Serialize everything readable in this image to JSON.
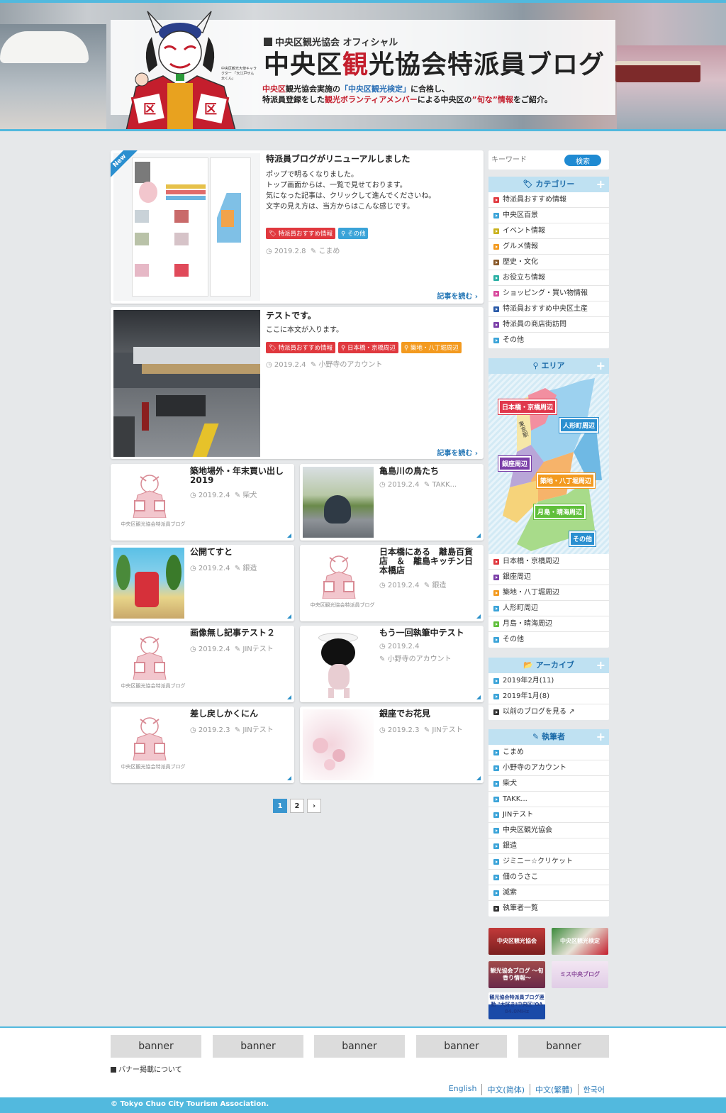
{
  "header": {
    "official": "中央区観光協会 オフィシャル",
    "title_pre": "中央区",
    "title_red": "観",
    "title_post": "光協会特派員ブログ",
    "tag1_a": "中央区",
    "tag1_b": "観光協会実施の",
    "tag1_c": "「中央区観光検定」",
    "tag1_d": "に合格し、",
    "tag2_a": "特派員登録をした",
    "tag2_b": "観光ボランティアメンバー",
    "tag2_c": "による中央区の",
    "tag2_d": "”旬な”情報",
    "tag2_e": "をご紹介。",
    "mascot_side": "中央区観光大使キャラクター 「大江戸せん太くん」"
  },
  "featured": [
    {
      "badge": "New",
      "title": "特派員ブログがリニューアルしました",
      "excerpt": [
        "ポップで明るくなりました。",
        "トップ画面からは、一覧で見せております。",
        "気になった記事は、クリックして進んでくださいね。",
        "文字の見え方は、当方からはこんな感じです。"
      ],
      "tags": [
        "特派員おすすめ情報",
        "その他"
      ],
      "date": "2019.2.8",
      "author": "こまめ",
      "readmore": "記事を読む"
    },
    {
      "title": "テストです。",
      "excerpt": [
        "ここに本文が入ります。"
      ],
      "tags": [
        "特派員おすすめ情報",
        "日本橋・京橋周辺",
        "築地・八丁堀周辺"
      ],
      "date": "2019.2.4",
      "author": "小野寺のアカウント",
      "readmore": "記事を読む"
    }
  ],
  "grid": [
    {
      "title": "築地場外・年末買い出し2019",
      "date": "2019.2.4",
      "author": "柴犬"
    },
    {
      "title": "亀島川の鳥たち",
      "date": "2019.2.4",
      "author": "TAKK..."
    },
    {
      "title": "公開てすと",
      "date": "2019.2.4",
      "author": "銀造"
    },
    {
      "title": "日本橋にある　離島百貨店　＆　離島キッチン日本橋店",
      "date": "2019.2.4",
      "author": "銀造"
    },
    {
      "title": "画像無し記事テスト２",
      "date": "2019.2.4",
      "author": "JINテスト"
    },
    {
      "title": "もう一回執筆中テスト",
      "date": "2019.2.4",
      "author": "小野寺のアカウント"
    },
    {
      "title": "差し戻しかくにん",
      "date": "2019.2.3",
      "author": "JINテスト"
    },
    {
      "title": "銀座でお花見",
      "date": "2019.2.3",
      "author": "JINテスト"
    }
  ],
  "logo_caption": "中央区観光協会特派員ブログ",
  "pager": {
    "p1": "1",
    "p2": "2",
    "next": "›"
  },
  "search": {
    "placeholder": "キーワード",
    "button": "検索"
  },
  "categories": {
    "title": "カテゴリー",
    "items": [
      "特派員おすすめ情報",
      "中央区百景",
      "イベント情報",
      "グルメ情報",
      "歴史・文化",
      "お役立ち情報",
      "ショッピング・買い物情報",
      "特派員おすすめ中央区土産",
      "特派員の商店街訪問",
      "その他"
    ]
  },
  "area": {
    "title": "エリア",
    "map_labels": [
      "日本橋・京橋周辺",
      "人形町周辺",
      "銀座周辺",
      "築地・八丁堀周辺",
      "月島・晴海周辺",
      "その他"
    ],
    "station": "東京駅",
    "items": [
      "日本橋・京橋周辺",
      "銀座周辺",
      "築地・八丁堀周辺",
      "人形町周辺",
      "月島・晴海周辺",
      "その他"
    ]
  },
  "archive": {
    "title": "アーカイブ",
    "items": [
      "2019年2月(11)",
      "2019年1月(8)",
      "以前のブログを見る"
    ]
  },
  "authors": {
    "title": "執筆者",
    "items": [
      "こまめ",
      "小野寺のアカウント",
      "柴犬",
      "TAKK...",
      "JINテスト",
      "中央区観光協会",
      "銀造",
      "ジミニー☆クリケット",
      "佃のうさこ",
      "滅紫",
      "執筆者一覧"
    ]
  },
  "side_banners": [
    "中央区観光協会",
    "中央区観光検定",
    "観光協会ブログ ～旬香り情報～",
    "ミス中央ブログ",
    "観光協会特派員ブログ連動 \"大好き!中央区\"OA 84.0MHz"
  ],
  "footer": {
    "banners": [
      "banner",
      "banner",
      "banner",
      "banner",
      "banner"
    ],
    "banner_info": "バナー掲載について",
    "langs": [
      "English",
      "中文(简体)",
      "中文(繁體)",
      "한국어"
    ],
    "copyright": "© Tokyo Chuo City Tourism Association."
  },
  "colors": {
    "accent": "#52b9de",
    "link": "#2a7ab8",
    "tag_red": "#e0383e",
    "tag_blue": "#3aa3d8",
    "tag_orange": "#f39a1f",
    "category_icons": [
      "#e0383e",
      "#3aa3d8",
      "#c9b21e",
      "#f39a1f",
      "#8a5a2b",
      "#2ab0a4",
      "#d8489c",
      "#2a5aa8",
      "#7b3fa8",
      "#3aa3d8"
    ],
    "area_icons": [
      "#e0383e",
      "#7b3fa8",
      "#f39a1f",
      "#3aa3d8",
      "#5fbf3a",
      "#3aa3d8"
    ]
  }
}
